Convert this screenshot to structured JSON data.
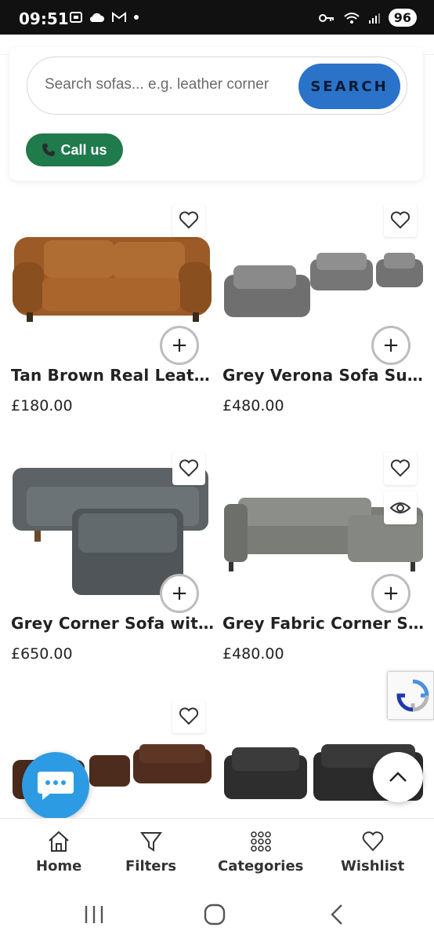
{
  "status_bar": {
    "time": "09:51",
    "left_icons": [
      "screenshot-icon",
      "cloud-icon",
      "gmail-icon",
      "dot-icon"
    ],
    "right_icons": [
      "key-icon",
      "wifi-icon",
      "signal-icon"
    ],
    "battery": "96"
  },
  "search": {
    "placeholder": "Search sofas... e.g. leather corner",
    "button_label": "SEARCH"
  },
  "call_button": {
    "label": "Call us",
    "icon": "phone-icon"
  },
  "products": [
    {
      "title": "Tan Brown Real Leathe...",
      "price": "£180.00"
    },
    {
      "title": "Grey Verona Sofa Suite...",
      "price": "£480.00"
    },
    {
      "title": "Grey Corner Sofa with ...",
      "price": "£650.00"
    },
    {
      "title": "Grey Fabric Corner Sof...",
      "price": "£480.00"
    },
    {
      "title": "",
      "price": ""
    },
    {
      "title": "",
      "price": ""
    }
  ],
  "bottom_nav": {
    "items": [
      {
        "label": "Home",
        "icon": "home-icon"
      },
      {
        "label": "Filters",
        "icon": "filter-icon"
      },
      {
        "label": "Categories",
        "icon": "grid-dots-icon"
      },
      {
        "label": "Wishlist",
        "icon": "heart-icon"
      }
    ]
  },
  "colors": {
    "search_button": "#2a73c8",
    "call_button": "#1f7a4c",
    "chat_fab": "#2d9be3",
    "status_bar": "#111111"
  }
}
